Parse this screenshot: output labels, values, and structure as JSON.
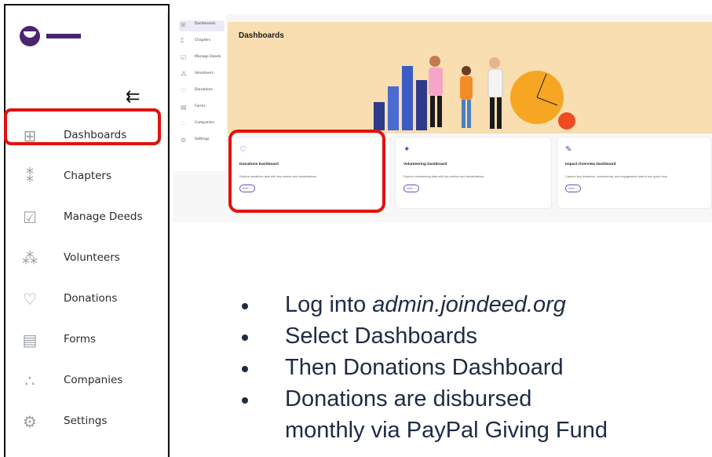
{
  "sidebar": {
    "logo": "joindeed-logo",
    "collapse_icon": "⇇",
    "items": [
      {
        "icon": "dashboard-icon",
        "glyph": "⊞",
        "label": "Dashboards"
      },
      {
        "icon": "chapters-icon",
        "glyph": "⁑",
        "label": "Chapters"
      },
      {
        "icon": "calendar-check-icon",
        "glyph": "☑",
        "label": "Manage Deeds"
      },
      {
        "icon": "volunteers-icon",
        "glyph": "⁂",
        "label": "Volunteers"
      },
      {
        "icon": "donation-hand-icon",
        "glyph": "♡",
        "label": "Donations"
      },
      {
        "icon": "forms-icon",
        "glyph": "▤",
        "label": "Forms"
      },
      {
        "icon": "companies-icon",
        "glyph": "∴",
        "label": "Companies"
      },
      {
        "icon": "settings-gear-icon",
        "glyph": "⚙",
        "label": "Settings"
      }
    ]
  },
  "mini_app": {
    "nav": [
      "Dashboards",
      "Chapters",
      "Manage Deeds",
      "Volunteers",
      "Donations",
      "Forms",
      "Companies",
      "Settings"
    ],
    "banner_title": "Dashboards",
    "cards": [
      {
        "icon": "♡",
        "title": "Donations Dashboard",
        "desc": "Explore donations data with key metrics and visualizations.",
        "button": "View →"
      },
      {
        "icon": "✦",
        "title": "Volunteering Dashboard",
        "desc": "Explore volunteering data with key metrics and visualizations.",
        "button": "View →"
      },
      {
        "icon": "✎",
        "title": "Impact Overview Dashboard",
        "desc": "Capture key donations, volunteering, and engagement data in one quick view.",
        "button": "View →"
      }
    ]
  },
  "bullets": {
    "b1_prefix": "Log into ",
    "b1_site": "admin.joindeed.org",
    "b2": "Select Dashboards",
    "b3": "Then Donations Dashboard",
    "b4": "Donations are disbursed",
    "b5": "monthly via PayPal Giving Fund"
  },
  "colors": {
    "highlight_red": "#e3120b",
    "brand_purple": "#4a2470",
    "banner_bg": "#f8deb0",
    "text_navy": "#1f2b44"
  }
}
